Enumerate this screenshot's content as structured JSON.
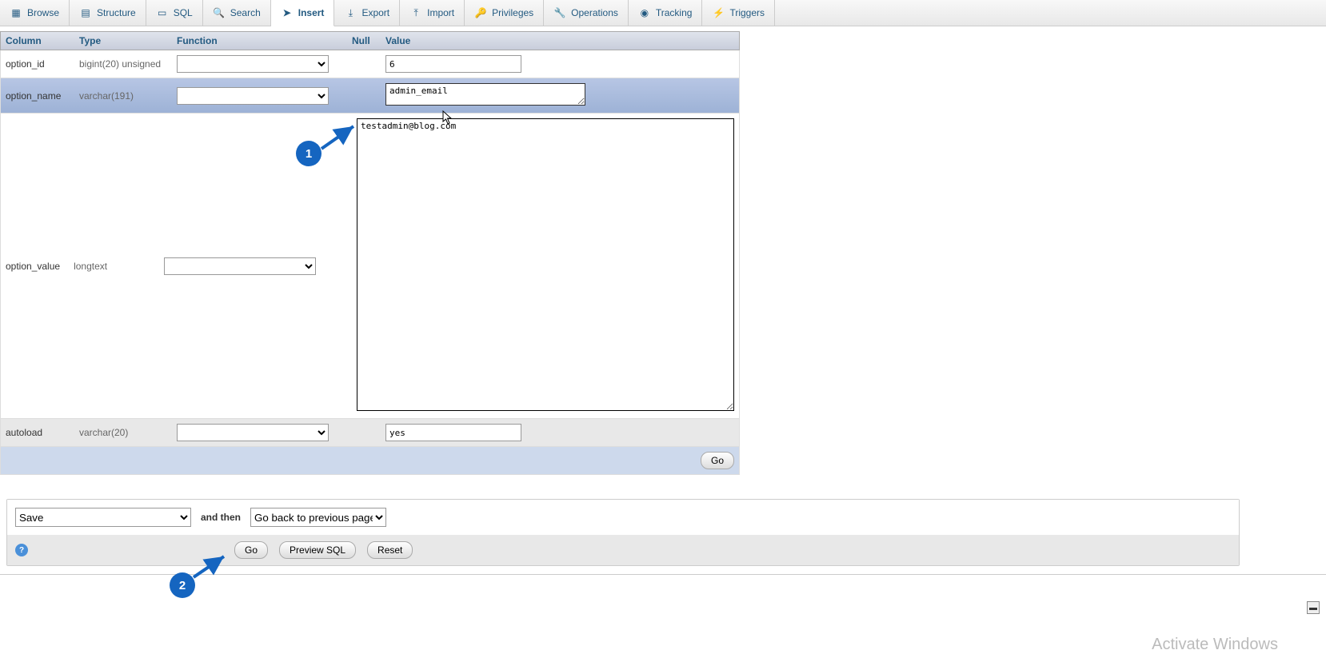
{
  "tabs": [
    {
      "label": "Browse",
      "icon": "▦"
    },
    {
      "label": "Structure",
      "icon": "▤"
    },
    {
      "label": "SQL",
      "icon": "▭"
    },
    {
      "label": "Search",
      "icon": "🔍"
    },
    {
      "label": "Insert",
      "icon": "➤",
      "active": true
    },
    {
      "label": "Export",
      "icon": "⤓"
    },
    {
      "label": "Import",
      "icon": "⤒"
    },
    {
      "label": "Privileges",
      "icon": "🔑"
    },
    {
      "label": "Operations",
      "icon": "🔧"
    },
    {
      "label": "Tracking",
      "icon": "◉"
    },
    {
      "label": "Triggers",
      "icon": "⚡"
    }
  ],
  "headers": {
    "column": "Column",
    "type": "Type",
    "function": "Function",
    "null": "Null",
    "value": "Value"
  },
  "rows": {
    "option_id": {
      "name": "option_id",
      "type": "bigint(20) unsigned",
      "value": "6"
    },
    "option_name": {
      "name": "option_name",
      "type": "varchar(191)",
      "value": "admin_email"
    },
    "option_value": {
      "name": "option_value",
      "type": "longtext",
      "value": "testadmin@blog.com"
    },
    "autoload": {
      "name": "autoload",
      "type": "varchar(20)",
      "value": "yes"
    }
  },
  "go_btn": "Go",
  "bottom": {
    "save_select": "Save",
    "and_then": "and then",
    "after_select": "Go back to previous page",
    "go": "Go",
    "preview": "Preview SQL",
    "reset": "Reset"
  },
  "callouts": {
    "c1": "1",
    "c2": "2"
  },
  "watermark": "Activate Windows"
}
